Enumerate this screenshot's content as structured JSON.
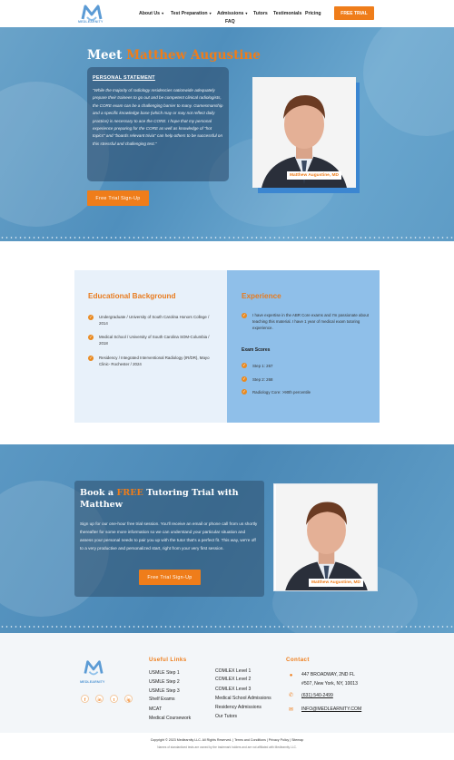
{
  "header": {
    "logo_text": "MEDLEARNITY",
    "nav": [
      {
        "label": "About Us",
        "caret": true
      },
      {
        "label": "Test Preparation",
        "caret": true
      },
      {
        "label": "Admissions",
        "caret": true
      },
      {
        "label": "Tutors",
        "caret": false
      },
      {
        "label": "Testimonials",
        "caret": false
      },
      {
        "label": "Pricing",
        "caret": false
      },
      {
        "label": "FAQ",
        "caret": false
      }
    ],
    "cta": "FREE TRIAL"
  },
  "hero": {
    "title_prefix": "Meet ",
    "title_name": "Matthew Augustine",
    "statement_heading": "PERSONAL STATEMENT",
    "statement_text": "\"While the majority of radiology residencies nationwide adequately prepare their trainees to go out and be competent clinical radiologists, the CORE exam can be a challenging barrier to many. Gamesmanship and a specific knowledge base (which may or may not reflect daily practice) is necessary to ace the CORE. I hope that my personal experience preparing for the CORE as well as knowledge of \"hot topics\" and \"boards relevant trivia\" can help others to be successful on this stressful and challenging test.\"",
    "cta": "Free Trial Sign-Up",
    "photo_caption": "Matthew Augustine, MD"
  },
  "education": {
    "heading": "Educational Background",
    "items": [
      "Undergraduate / University of South Carolina Honors College / 2014",
      "Medical School / University of South Carolina SOM-Columbia / 2018",
      "Residency / Integrated Interventional Radiology (IR/DR), Mayo Clinic- Rochester / 2024"
    ]
  },
  "experience": {
    "heading": "Experience",
    "text": "I have expertise in the ABR Core exams and I'm passionate about teaching this material. I have 1 year of medical exam tutoring experience.",
    "scores_heading": "Exam Scores",
    "scores": [
      "Step 1: 267",
      "Step 2: 268",
      "Radiology Core: >90th percentile"
    ]
  },
  "booking": {
    "title_a": "Book a ",
    "title_hl": "FREE",
    "title_b": " Tutoring Trial with Matthew",
    "text": "Sign up for our one-hour free trial session. You'll receive an email or phone call from us shortly thereafter for some more information so we can understand your particular situation and assess your personal needs to pair you up with the tutor that's a perfect fit. This way, we're off to a very productive and personalized start, right from your very first session.",
    "cta": "Free Trial Sign-Up",
    "photo_caption": "Matthew Augustine, MD"
  },
  "footer": {
    "logo_text": "MEDLEARNITY",
    "social": [
      "f",
      "in",
      "t",
      "ig"
    ],
    "useful_links_heading": "Useful Links",
    "links_col1": [
      "USMLE Step 1",
      "USMLE Step 2",
      "USMLE Step 3",
      "Shelf Exams",
      "MCAT",
      "Medical Coursework"
    ],
    "links_col2": [
      "COMLEX Level 1",
      "COMLEX Level 2",
      "COMLEX Level 3",
      "Medical School Admissions",
      "Residency Admissions",
      "Our Tutors"
    ],
    "contact_heading": "Contact",
    "address_1": "447 BROADWAY, 2ND FL",
    "address_2": "#507, New York, NY, 10013",
    "phone": "(631) 540-2499",
    "email": "INFO@MEDLEARNITY.COM",
    "copyright": "Copyright © 2023 Medlearnity LLC. All Rights Reserved. | Terms and Conditions | Privacy Policy | Sitemap",
    "disclaimer": "Names of standardized tests are owned by the trademark holders and are not affiliated with Medlearnity LLC."
  }
}
